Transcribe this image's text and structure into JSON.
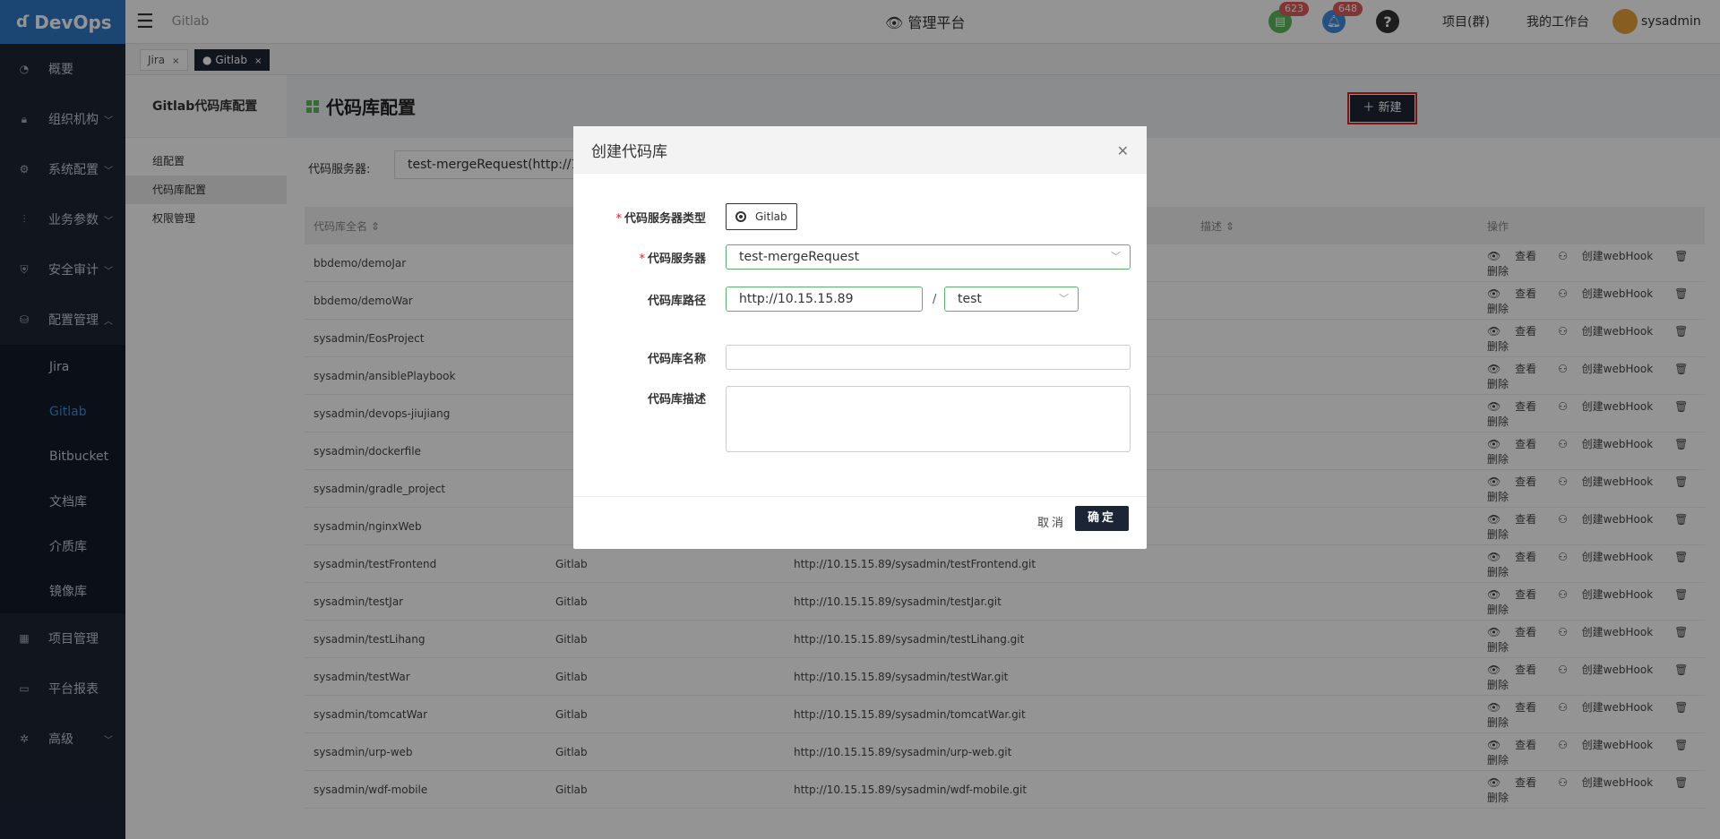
{
  "app": {
    "logo": "DevOps",
    "breadcrumb": "Gitlab",
    "platform": "管理平台"
  },
  "header": {
    "badges": [
      {
        "icon": "doc-icon",
        "count": "623",
        "color": "#5cb85c"
      },
      {
        "icon": "bell-icon",
        "count": "648",
        "color": "#3d8de0"
      }
    ],
    "help": "?",
    "nav": [
      "项目(群)",
      "我的工作台"
    ],
    "user": "sysadmin"
  },
  "sidebar": {
    "items": [
      {
        "label": "概要"
      },
      {
        "label": "组织机构"
      },
      {
        "label": "系统配置"
      },
      {
        "label": "业务参数"
      },
      {
        "label": "安全审计"
      },
      {
        "label": "配置管理"
      }
    ],
    "sub_items": [
      {
        "label": "Jira"
      },
      {
        "label": "Gitlab"
      },
      {
        "label": "Bitbucket"
      },
      {
        "label": "文档库"
      },
      {
        "label": "介质库"
      },
      {
        "label": "镜像库"
      }
    ],
    "bottom_items": [
      {
        "label": "项目管理"
      },
      {
        "label": "平台报表"
      },
      {
        "label": "高级"
      }
    ]
  },
  "tabs": [
    {
      "label": "Jira"
    },
    {
      "label": "Gitlab"
    }
  ],
  "leftpanel": {
    "title": "Gitlab代码库配置",
    "items": [
      "组配置",
      "代码库配置",
      "权限管理"
    ]
  },
  "page": {
    "title": "代码库配置",
    "filter_label": "代码服务器:",
    "filter_value": "test-mergeRequest(http://1",
    "new_button": "＋ 新建"
  },
  "table": {
    "headers": [
      "代码库全名",
      "描述",
      "操作"
    ],
    "ops": [
      "查看",
      "创建webHook",
      "删除"
    ],
    "rows": [
      {
        "name": "bbdemo/demoJar",
        "type": "",
        "url": ""
      },
      {
        "name": "bbdemo/demoWar",
        "type": "",
        "url": ""
      },
      {
        "name": "sysadmin/EosProject",
        "type": "",
        "url": ""
      },
      {
        "name": "sysadmin/ansiblePlaybook",
        "type": "",
        "url": ""
      },
      {
        "name": "sysadmin/devops-jiujiang",
        "type": "",
        "url": ""
      },
      {
        "name": "sysadmin/dockerfile",
        "type": "",
        "url": ""
      },
      {
        "name": "sysadmin/gradle_project",
        "type": "",
        "url": ""
      },
      {
        "name": "sysadmin/nginxWeb",
        "type": "",
        "url": ""
      },
      {
        "name": "sysadmin/testFrontend",
        "type": "Gitlab",
        "url": "http://10.15.15.89/sysadmin/testFrontend.git"
      },
      {
        "name": "sysadmin/testJar",
        "type": "Gitlab",
        "url": "http://10.15.15.89/sysadmin/testJar.git"
      },
      {
        "name": "sysadmin/testLihang",
        "type": "Gitlab",
        "url": "http://10.15.15.89/sysadmin/testLihang.git"
      },
      {
        "name": "sysadmin/testWar",
        "type": "Gitlab",
        "url": "http://10.15.15.89/sysadmin/testWar.git"
      },
      {
        "name": "sysadmin/tomcatWar",
        "type": "Gitlab",
        "url": "http://10.15.15.89/sysadmin/tomcatWar.git"
      },
      {
        "name": "sysadmin/urp-web",
        "type": "Gitlab",
        "url": "http://10.15.15.89/sysadmin/urp-web.git"
      },
      {
        "name": "sysadmin/wdf-mobile",
        "type": "Gitlab",
        "url": "http://10.15.15.89/sysadmin/wdf-mobile.git"
      }
    ]
  },
  "modal": {
    "title": "创建代码库",
    "server_type_label": "代码服务器类型",
    "server_type_value": "Gitlab",
    "server_label": "代码服务器",
    "server_value": "test-mergeRequest",
    "path_label": "代码库路径",
    "path_host": "http://10.15.15.89",
    "path_separator": "/",
    "path_group": "test",
    "name_label": "代码库名称",
    "name_value": "",
    "desc_label": "代码库描述",
    "desc_value": "",
    "cancel": "取消",
    "ok": "确定"
  }
}
